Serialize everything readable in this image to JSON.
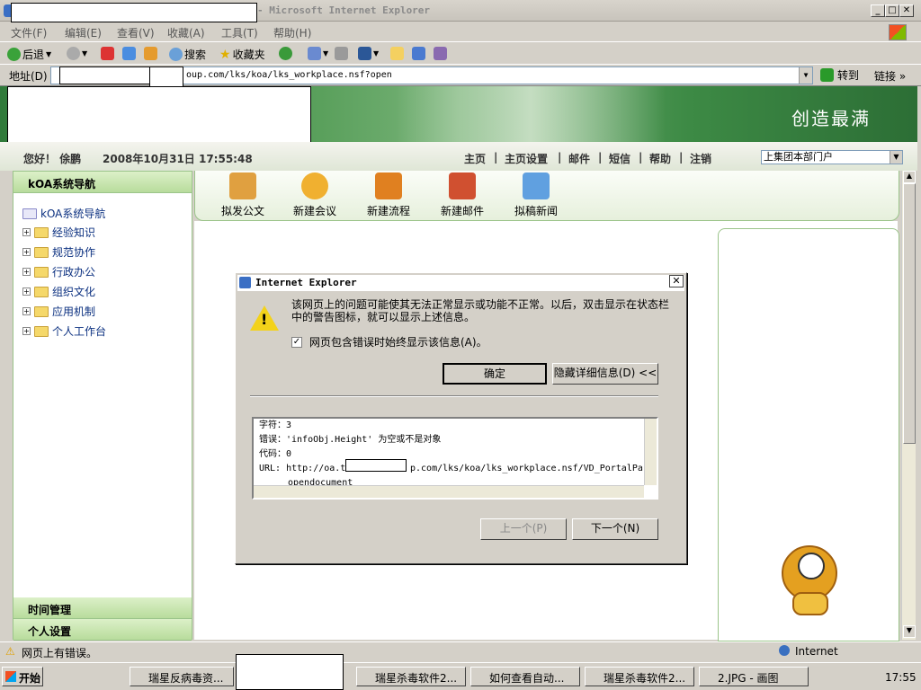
{
  "window": {
    "title": "- Microsoft Internet Explorer"
  },
  "menu": [
    "文件(F)",
    "编辑(E)",
    "查看(V)",
    "收藏(A)",
    "工具(T)",
    "帮助(H)"
  ],
  "toolbar": {
    "back": "后退",
    "search": "搜索",
    "favorites": "收藏夹"
  },
  "address": {
    "label": "地址(D)",
    "url": "oup.com/lks/koa/lks_workplace.nsf?open",
    "go": "转到",
    "links": "链接 »"
  },
  "banner": {
    "slogan": "创造最满"
  },
  "userbar": {
    "greeting": "您好！ 俆鹏",
    "datetime": "2008年10月31日 17:55:48",
    "nav": [
      "主页",
      "主页设置",
      "邮件",
      "短信",
      "帮助",
      "注销"
    ],
    "portal": "上集团本部门户"
  },
  "sidebar": {
    "title": "kOA系统导航",
    "root": "kOA系统导航",
    "items": [
      "经验知识",
      "规范协作",
      "行政办公",
      "组织文化",
      "应用机制",
      "个人工作台"
    ],
    "footer": [
      "时间管理",
      "个人设置"
    ]
  },
  "quick": [
    "拟发公文",
    "新建会议",
    "新建流程",
    "新建邮件",
    "拟稿新闻"
  ],
  "dialog": {
    "title": "Internet Explorer",
    "message": "该网页上的问题可能使其无法正常显示或功能不正常。以后，双击显示在状态栏中的警告图标，就可以显示上述信息。",
    "checkbox": "网页包含错误时始终显示该信息(A)。",
    "ok": "确定",
    "hide_details": "隐藏详细信息(D) <<",
    "detail_lines": [
      "字符：3",
      "错误：'infoObj.Height' 为空或不是对象",
      "代码：0",
      "URL: http://oa.t",
      "opendocument"
    ],
    "detail_url_tail": "p.com/lks/koa/lks_workplace.nsf/VD_PortalPa",
    "prev": "上一个(P)",
    "next": "下一个(N)"
  },
  "statusbar": {
    "text": "网页上有错误。",
    "zone": "Internet"
  },
  "taskbar": {
    "start": "开始",
    "tasks": [
      "瑞星反病毒资...",
      "瑞星杀毒软件2...",
      "如何查看自动...",
      "瑞星杀毒软件2...",
      "2.JPG - 画图"
    ],
    "clock": "17:55"
  }
}
